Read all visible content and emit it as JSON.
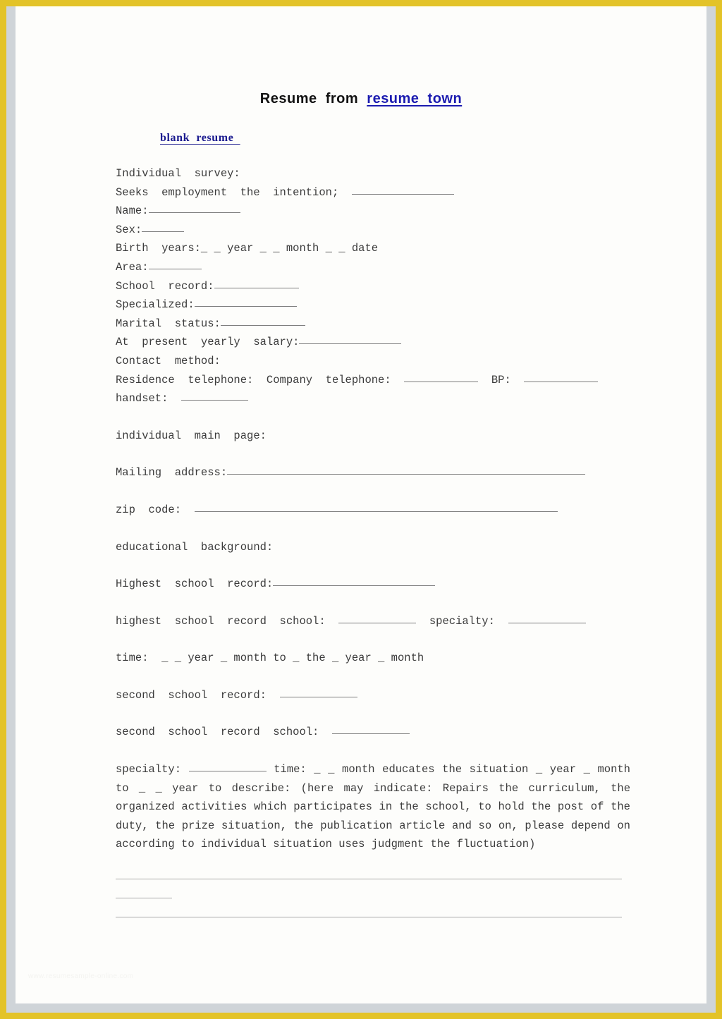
{
  "frame": {
    "outer_color": "#e3c328",
    "inner_color": "#cfd4d8",
    "page_color": "#fdfdfb"
  },
  "header": {
    "title_prefix": "Resume  from  ",
    "title_link": "resume  town",
    "link_color": "#1b1bb0",
    "subtitle": "blank  resume  ",
    "subtitle_color": "#1b1b8f"
  },
  "body": {
    "l1": "Individual  survey:",
    "l2a": "Seeks  employment  the  intention;  ",
    "l3a": "Name:",
    "l4a": "Sex:",
    "l5": "Birth  years:_ _ year _ _ month _ _ date",
    "l6a": "Area:",
    "l7a": "School  record:",
    "l8a": "Specialized:",
    "l9a": "Marital  status:",
    "l10a": "At  present  yearly  salary:",
    "l11": "Contact  method:",
    "l12a": "Residence  telephone:  Company  telephone:  ",
    "l12b": "  BP:  ",
    "l13a": "handset:  ",
    "l14": "individual  main  page:",
    "l15a": "Mailing  address:",
    "l16a": "zip  code:  ",
    "l17": "educational  background:",
    "l18a": "Highest  school  record:",
    "l19a": "highest  school  record  school:  ",
    "l19b": "  specialty:  ",
    "l20": "time:  _ _ year _ month to _ the _ year _ month",
    "l21a": "second  school  record:  ",
    "l22a": "second  school  record  school:  ",
    "l23a": "specialty:  ",
    "l23b": "  time:  _ _ month educates the situation _ year _ month to _ _ year to describe: (here may indicate: Repairs the curriculum, the organized activities which participates in the school, to hold the post of the duty, the prize situation, the publication article and so on, please depend on according to individual situation uses judgment the fluctuation)"
  },
  "footer": {
    "watermark": "www.resumesample-online.com"
  }
}
